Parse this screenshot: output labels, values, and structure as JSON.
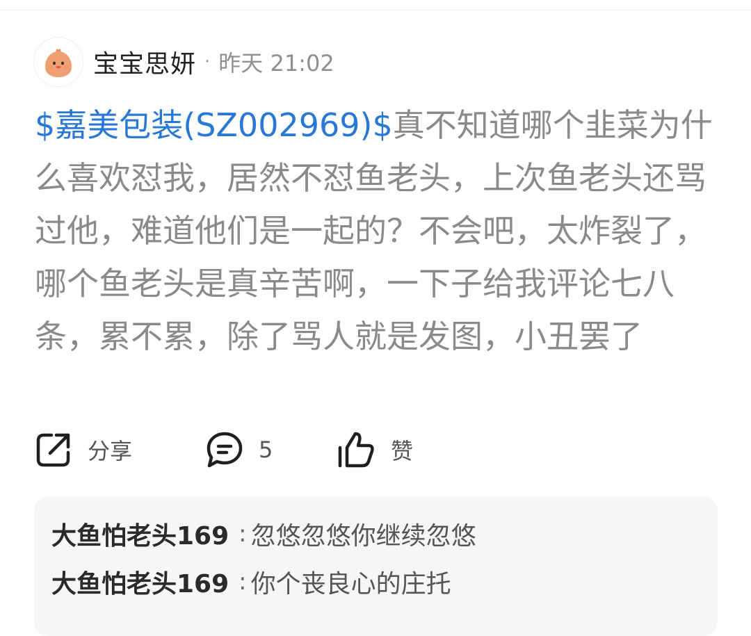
{
  "post": {
    "author": "宝宝思妍",
    "separator": "·",
    "time": "昨天 21:02",
    "stock_tag": "$嘉美包装(SZ002969)$",
    "body": "真不知道哪个韭菜为什么喜欢怼我，居然不怼鱼老头，上次鱼老头还骂过他，难道他们是一起的？不会吧，太炸裂了，哪个鱼老头是真辛苦啊，一下子给我评论七八条，累不累，除了骂人就是发图，小丑罢了"
  },
  "actions": {
    "share_label": "分享",
    "comment_count": "5",
    "like_label": "赞"
  },
  "comments": [
    {
      "user": "大鱼怕老头169",
      "sep": ":",
      "text": "忽悠忽悠你继续忽悠"
    },
    {
      "user": "大鱼怕老头169",
      "sep": ":",
      "text": "你个丧良心的庄托"
    }
  ],
  "colors": {
    "stock_link": "#2878d8",
    "body_text": "#8a8a8a",
    "avatar_chick": "#f0a070"
  },
  "icons": {
    "avatar": "chick-avatar-icon",
    "share": "share-icon",
    "comment": "comment-bubble-icon",
    "like": "thumbs-up-icon"
  }
}
